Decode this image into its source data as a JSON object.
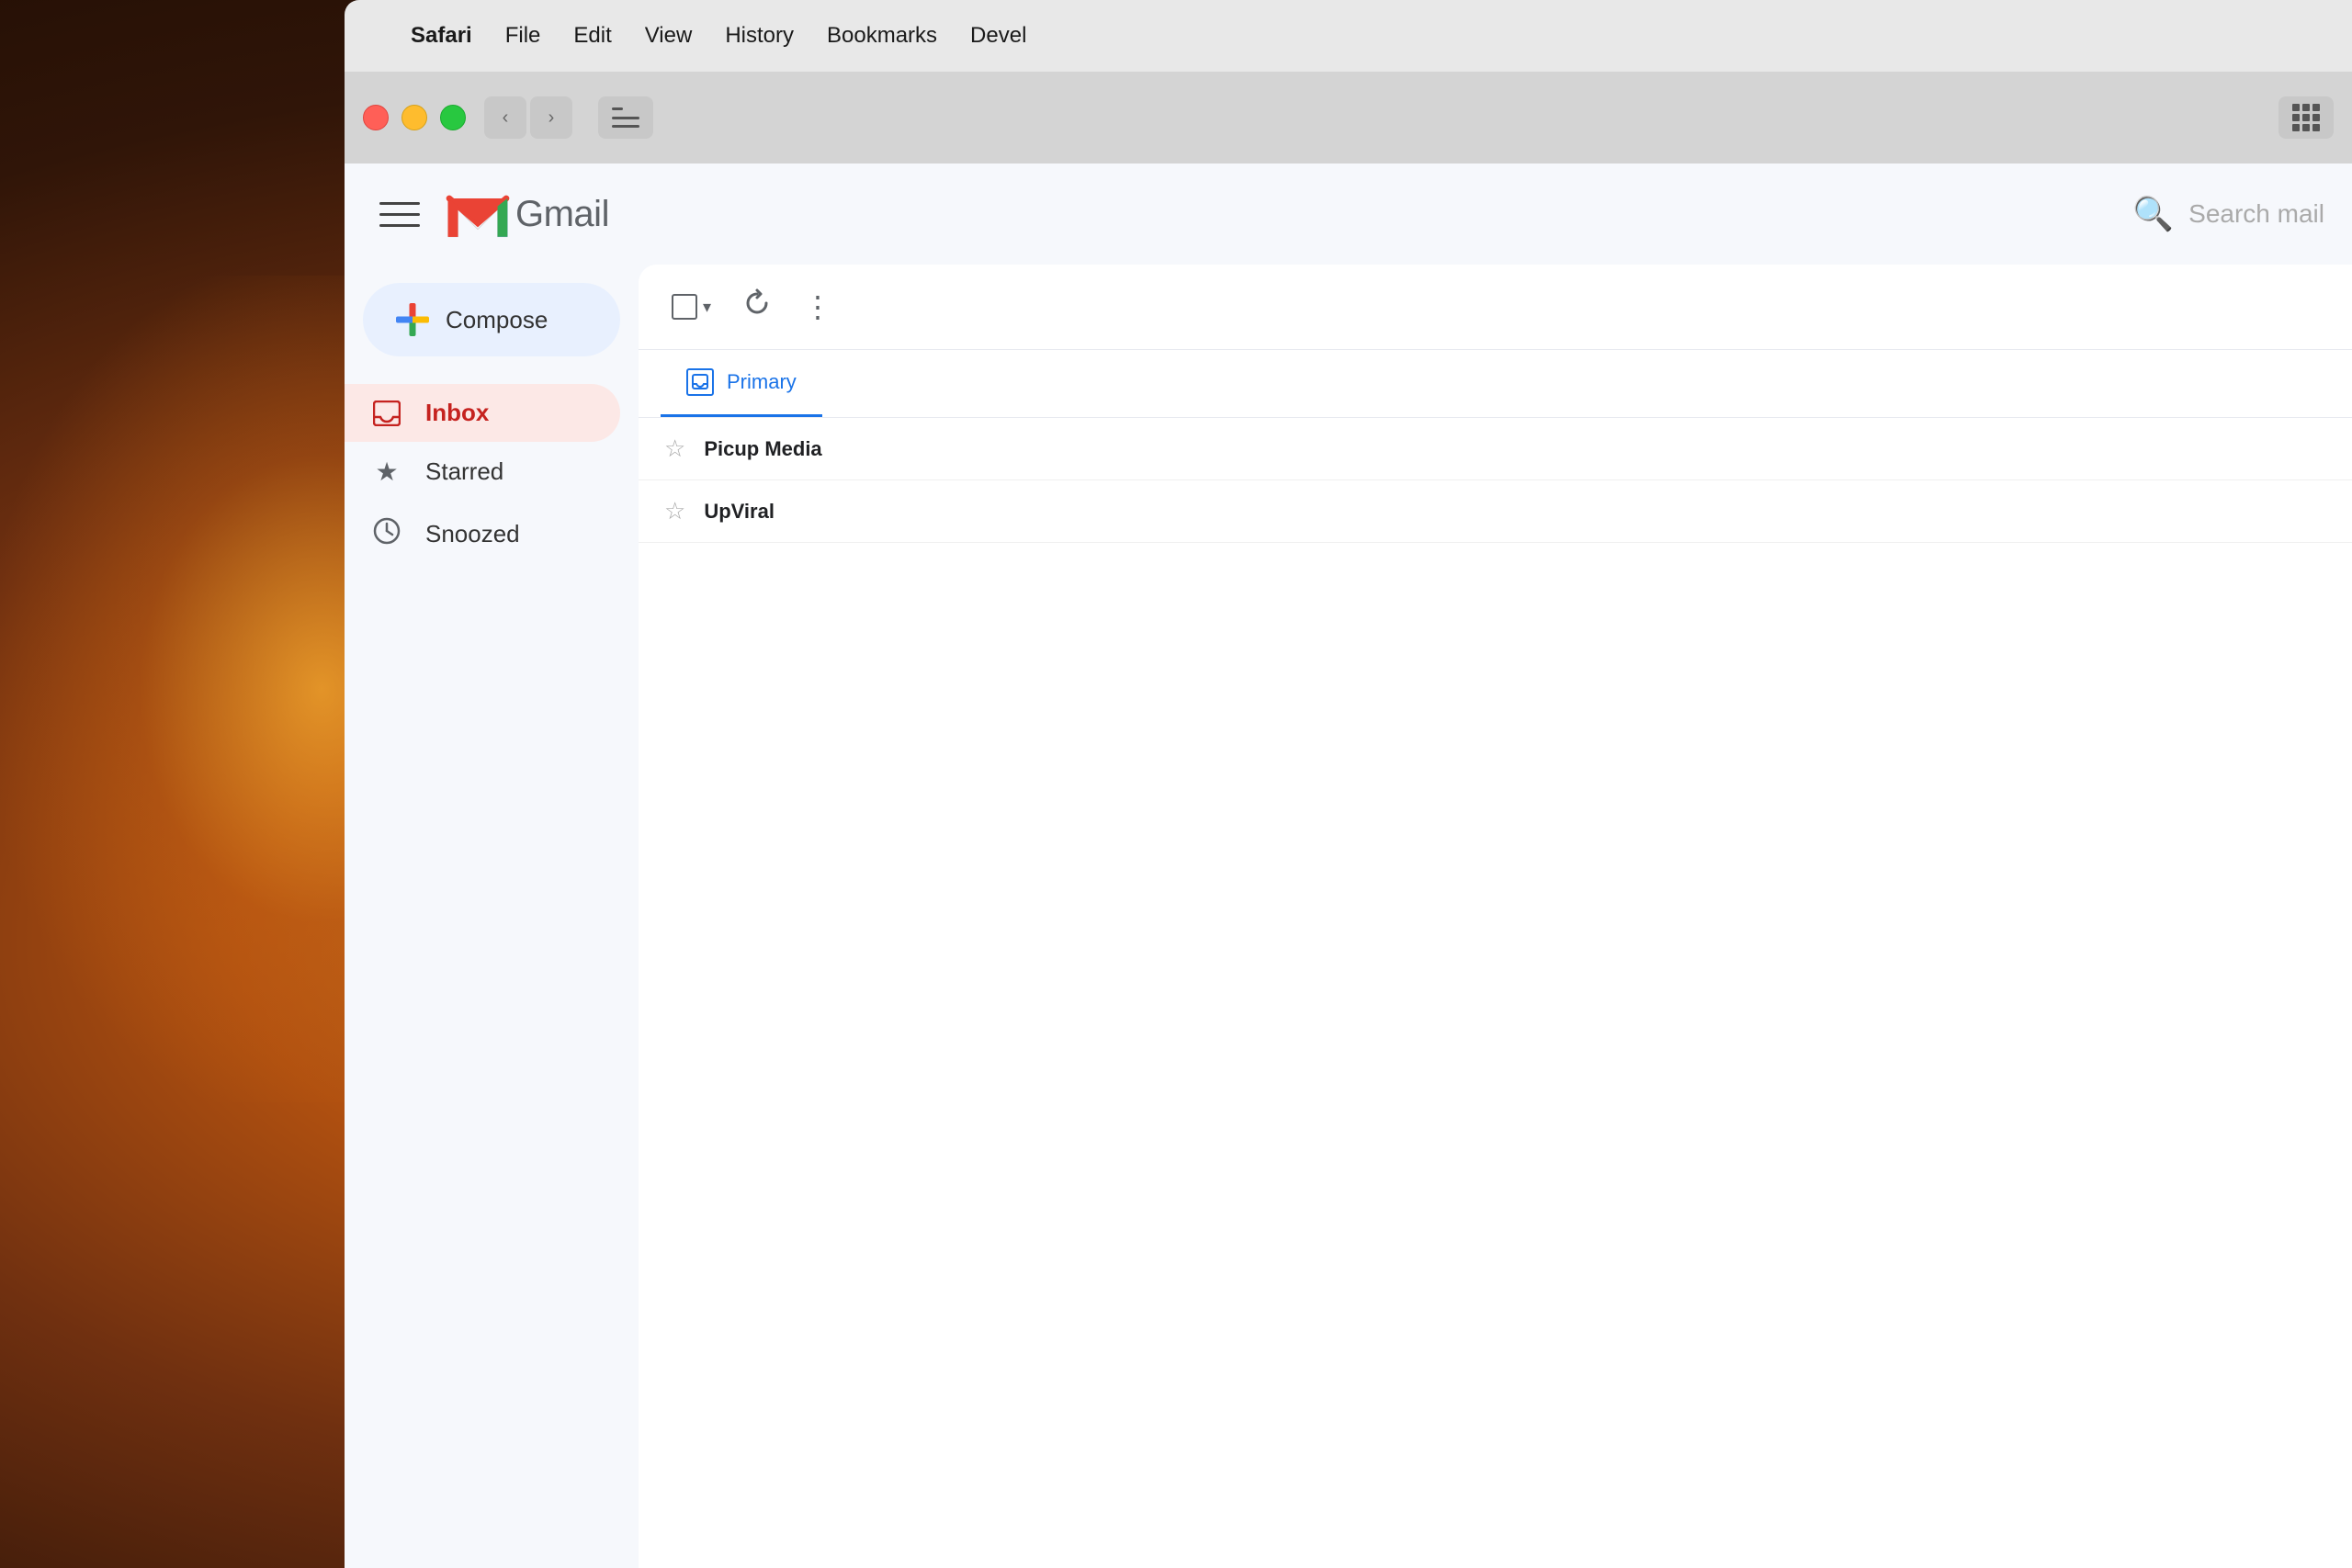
{
  "background": {
    "description": "Warm bokeh background with glowing light"
  },
  "menu_bar": {
    "apple_symbol": "",
    "items": [
      {
        "label": "Safari",
        "bold": true
      },
      {
        "label": "File"
      },
      {
        "label": "Edit"
      },
      {
        "label": "View"
      },
      {
        "label": "History"
      },
      {
        "label": "Bookmarks"
      },
      {
        "label": "Devel"
      }
    ]
  },
  "browser_chrome": {
    "traffic_lights": [
      "red",
      "yellow",
      "green"
    ],
    "nav": {
      "back_label": "‹",
      "forward_label": "›"
    }
  },
  "gmail": {
    "header": {
      "app_name": "Gmail",
      "search_placeholder": "Search mail"
    },
    "sidebar": {
      "compose_label": "Compose",
      "nav_items": [
        {
          "id": "inbox",
          "label": "Inbox",
          "active": true
        },
        {
          "id": "starred",
          "label": "Starred",
          "active": false
        },
        {
          "id": "snoozed",
          "label": "Snoozed",
          "active": false
        }
      ]
    },
    "toolbar": {
      "more_options_label": "⋮",
      "refresh_label": "↺"
    },
    "tabs": [
      {
        "id": "primary",
        "label": "Primary",
        "active": true
      }
    ],
    "emails": [
      {
        "sender": "Picup Media",
        "starred": false
      },
      {
        "sender": "UpViral",
        "starred": false
      }
    ]
  }
}
